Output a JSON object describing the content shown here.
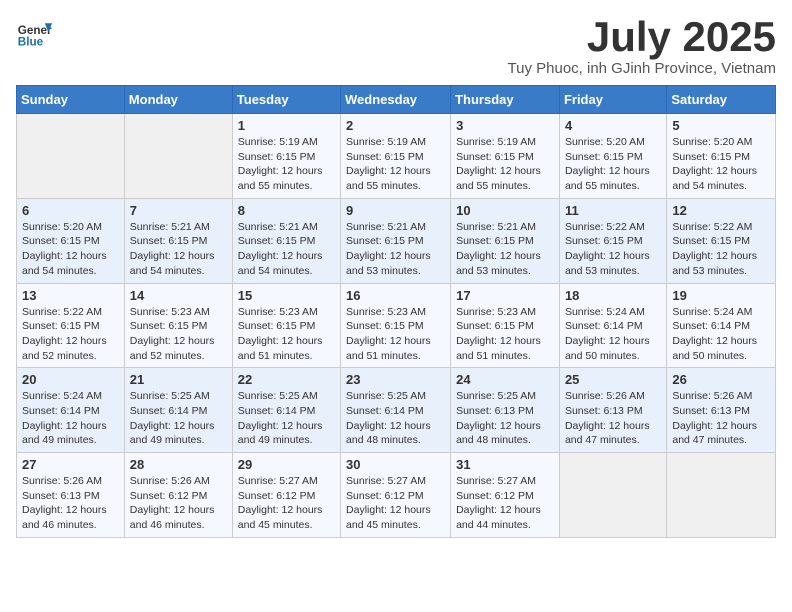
{
  "logo": {
    "line1": "General",
    "line2": "Blue"
  },
  "title": "July 2025",
  "subtitle": "Tuy Phuoc, inh GJinh Province, Vietnam",
  "days_of_week": [
    "Sunday",
    "Monday",
    "Tuesday",
    "Wednesday",
    "Thursday",
    "Friday",
    "Saturday"
  ],
  "weeks": [
    [
      {
        "day": "",
        "info": ""
      },
      {
        "day": "",
        "info": ""
      },
      {
        "day": "1",
        "info": "Sunrise: 5:19 AM\nSunset: 6:15 PM\nDaylight: 12 hours and 55 minutes."
      },
      {
        "day": "2",
        "info": "Sunrise: 5:19 AM\nSunset: 6:15 PM\nDaylight: 12 hours and 55 minutes."
      },
      {
        "day": "3",
        "info": "Sunrise: 5:19 AM\nSunset: 6:15 PM\nDaylight: 12 hours and 55 minutes."
      },
      {
        "day": "4",
        "info": "Sunrise: 5:20 AM\nSunset: 6:15 PM\nDaylight: 12 hours and 55 minutes."
      },
      {
        "day": "5",
        "info": "Sunrise: 5:20 AM\nSunset: 6:15 PM\nDaylight: 12 hours and 54 minutes."
      }
    ],
    [
      {
        "day": "6",
        "info": "Sunrise: 5:20 AM\nSunset: 6:15 PM\nDaylight: 12 hours and 54 minutes."
      },
      {
        "day": "7",
        "info": "Sunrise: 5:21 AM\nSunset: 6:15 PM\nDaylight: 12 hours and 54 minutes."
      },
      {
        "day": "8",
        "info": "Sunrise: 5:21 AM\nSunset: 6:15 PM\nDaylight: 12 hours and 54 minutes."
      },
      {
        "day": "9",
        "info": "Sunrise: 5:21 AM\nSunset: 6:15 PM\nDaylight: 12 hours and 53 minutes."
      },
      {
        "day": "10",
        "info": "Sunrise: 5:21 AM\nSunset: 6:15 PM\nDaylight: 12 hours and 53 minutes."
      },
      {
        "day": "11",
        "info": "Sunrise: 5:22 AM\nSunset: 6:15 PM\nDaylight: 12 hours and 53 minutes."
      },
      {
        "day": "12",
        "info": "Sunrise: 5:22 AM\nSunset: 6:15 PM\nDaylight: 12 hours and 53 minutes."
      }
    ],
    [
      {
        "day": "13",
        "info": "Sunrise: 5:22 AM\nSunset: 6:15 PM\nDaylight: 12 hours and 52 minutes."
      },
      {
        "day": "14",
        "info": "Sunrise: 5:23 AM\nSunset: 6:15 PM\nDaylight: 12 hours and 52 minutes."
      },
      {
        "day": "15",
        "info": "Sunrise: 5:23 AM\nSunset: 6:15 PM\nDaylight: 12 hours and 51 minutes."
      },
      {
        "day": "16",
        "info": "Sunrise: 5:23 AM\nSunset: 6:15 PM\nDaylight: 12 hours and 51 minutes."
      },
      {
        "day": "17",
        "info": "Sunrise: 5:23 AM\nSunset: 6:15 PM\nDaylight: 12 hours and 51 minutes."
      },
      {
        "day": "18",
        "info": "Sunrise: 5:24 AM\nSunset: 6:14 PM\nDaylight: 12 hours and 50 minutes."
      },
      {
        "day": "19",
        "info": "Sunrise: 5:24 AM\nSunset: 6:14 PM\nDaylight: 12 hours and 50 minutes."
      }
    ],
    [
      {
        "day": "20",
        "info": "Sunrise: 5:24 AM\nSunset: 6:14 PM\nDaylight: 12 hours and 49 minutes."
      },
      {
        "day": "21",
        "info": "Sunrise: 5:25 AM\nSunset: 6:14 PM\nDaylight: 12 hours and 49 minutes."
      },
      {
        "day": "22",
        "info": "Sunrise: 5:25 AM\nSunset: 6:14 PM\nDaylight: 12 hours and 49 minutes."
      },
      {
        "day": "23",
        "info": "Sunrise: 5:25 AM\nSunset: 6:14 PM\nDaylight: 12 hours and 48 minutes."
      },
      {
        "day": "24",
        "info": "Sunrise: 5:25 AM\nSunset: 6:13 PM\nDaylight: 12 hours and 48 minutes."
      },
      {
        "day": "25",
        "info": "Sunrise: 5:26 AM\nSunset: 6:13 PM\nDaylight: 12 hours and 47 minutes."
      },
      {
        "day": "26",
        "info": "Sunrise: 5:26 AM\nSunset: 6:13 PM\nDaylight: 12 hours and 47 minutes."
      }
    ],
    [
      {
        "day": "27",
        "info": "Sunrise: 5:26 AM\nSunset: 6:13 PM\nDaylight: 12 hours and 46 minutes."
      },
      {
        "day": "28",
        "info": "Sunrise: 5:26 AM\nSunset: 6:12 PM\nDaylight: 12 hours and 46 minutes."
      },
      {
        "day": "29",
        "info": "Sunrise: 5:27 AM\nSunset: 6:12 PM\nDaylight: 12 hours and 45 minutes."
      },
      {
        "day": "30",
        "info": "Sunrise: 5:27 AM\nSunset: 6:12 PM\nDaylight: 12 hours and 45 minutes."
      },
      {
        "day": "31",
        "info": "Sunrise: 5:27 AM\nSunset: 6:12 PM\nDaylight: 12 hours and 44 minutes."
      },
      {
        "day": "",
        "info": ""
      },
      {
        "day": "",
        "info": ""
      }
    ]
  ]
}
